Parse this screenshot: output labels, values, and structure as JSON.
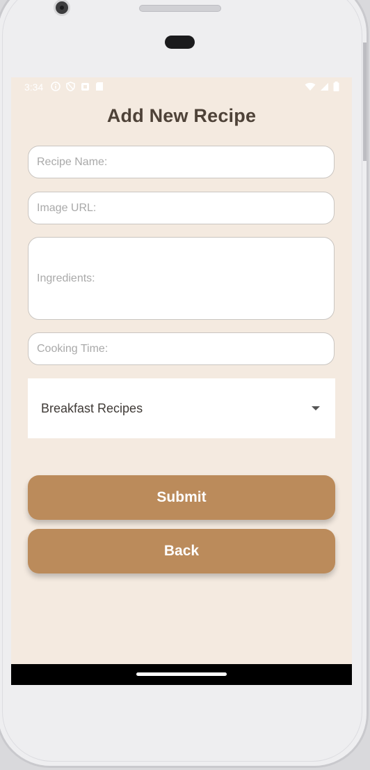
{
  "status_bar": {
    "time": "3:34",
    "left_icons": [
      "info-icon",
      "shield-icon",
      "notification-icon",
      "sd-card-icon"
    ],
    "right_icons": [
      "wifi-icon",
      "signal-icon",
      "battery-icon"
    ]
  },
  "page": {
    "title": "Add New Recipe"
  },
  "form": {
    "recipe_name": {
      "placeholder": "Recipe Name:",
      "value": ""
    },
    "image_url": {
      "placeholder": "Image URL:",
      "value": ""
    },
    "ingredients": {
      "placeholder": "Ingredients:",
      "value": ""
    },
    "cooking_time": {
      "placeholder": "Cooking Time:",
      "value": ""
    },
    "category": {
      "selected": "Breakfast Recipes"
    }
  },
  "buttons": {
    "submit_label": "Submit",
    "back_label": "Back"
  },
  "colors": {
    "background": "#f4eae0",
    "accent": "#bb8b5b",
    "title": "#4e4238"
  }
}
